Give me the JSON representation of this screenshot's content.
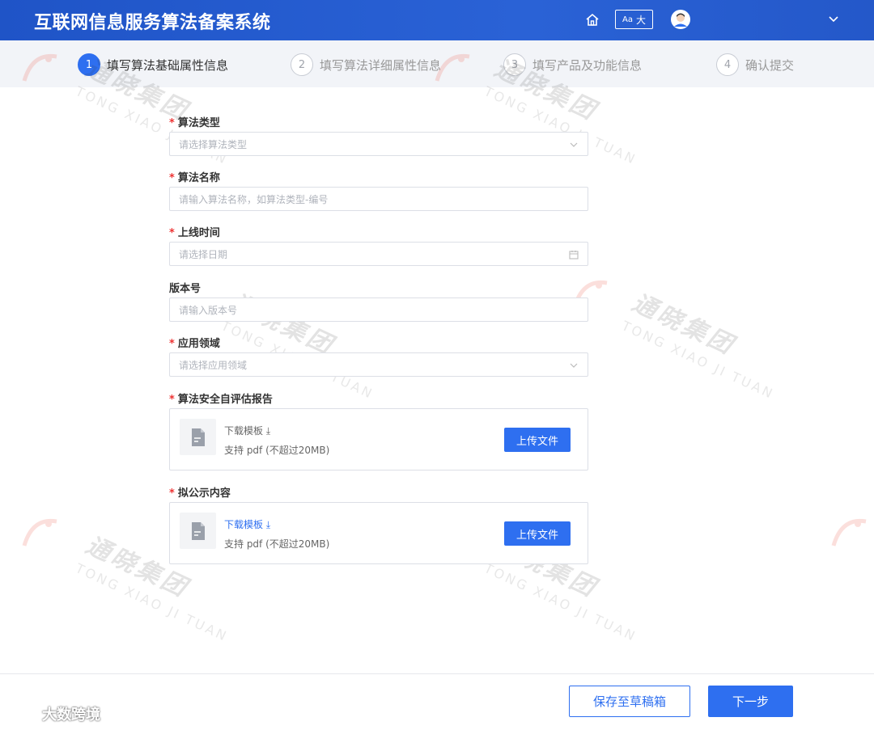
{
  "header": {
    "title": "互联网信息服务算法备案系统",
    "font_toggle": {
      "small": "Aa",
      "large": "大"
    }
  },
  "steps": [
    {
      "num": "1",
      "label": "填写算法基础属性信息",
      "active": true
    },
    {
      "num": "2",
      "label": "填写算法详细属性信息",
      "active": false
    },
    {
      "num": "3",
      "label": "填写产品及功能信息",
      "active": false
    },
    {
      "num": "4",
      "label": "确认提交",
      "active": false
    }
  ],
  "form": {
    "algorithm_type": {
      "label": "算法类型",
      "required": true,
      "placeholder": "请选择算法类型"
    },
    "algorithm_name": {
      "label": "算法名称",
      "required": true,
      "placeholder": "请输入算法名称，如算法类型-编号"
    },
    "launch_time": {
      "label": "上线时间",
      "required": true,
      "placeholder": "请选择日期"
    },
    "version": {
      "label": "版本号",
      "required": false,
      "placeholder": "请输入版本号"
    },
    "application_domain": {
      "label": "应用领域",
      "required": true,
      "placeholder": "请选择应用领域"
    },
    "self_assessment": {
      "label": "算法安全自评估报告",
      "required": true,
      "download": "下载模板",
      "hint": "支持 pdf (不超过20MB)",
      "upload": "上传文件"
    },
    "public_content": {
      "label": "拟公示内容",
      "required": true,
      "download": "下载模板",
      "hint": "支持 pdf (不超过20MB)",
      "upload": "上传文件"
    }
  },
  "footer": {
    "save_draft": "保存至草稿箱",
    "next": "下一步"
  },
  "watermark": {
    "cn": "通晓集团",
    "en": "TONG XIAO JI TUAN"
  },
  "source_mark": "大数跨境",
  "colors": {
    "primary": "#2e6ff0",
    "header": "#2458c9",
    "required": "#ee3333"
  }
}
